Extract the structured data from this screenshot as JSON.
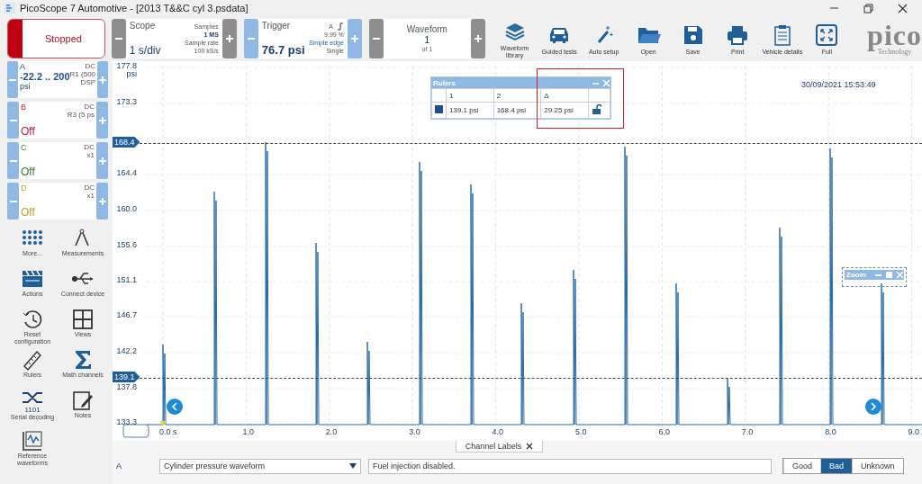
{
  "window": {
    "title": "PicoScope 7 Automotive - [2013 T&&C cyl 3.psdata]"
  },
  "run_button": {
    "label": "Stopped",
    "running": false
  },
  "scope": {
    "label": "Scope",
    "value": "1 s/div",
    "samples_label": "Samples",
    "samples": "1 MS",
    "rate_label": "Sample rate",
    "rate": "100 kS/s"
  },
  "trigger": {
    "label": "Trigger",
    "value": "76.7 psi",
    "channel": "A",
    "percent": "9.99 %",
    "type": "Simple edge",
    "mode": "Single"
  },
  "waveform": {
    "label": "Waveform",
    "value": "1",
    "of": "of 1"
  },
  "toolbar": [
    {
      "label": "Waveform library"
    },
    {
      "label": "Guided tests"
    },
    {
      "label": "Auto setup"
    },
    {
      "label": "Open"
    },
    {
      "label": "Save"
    },
    {
      "label": "Print"
    },
    {
      "label": "Vehicle details"
    },
    {
      "label": "Full"
    }
  ],
  "logo": {
    "name": "pico",
    "tagline": "Technology"
  },
  "channels": [
    {
      "name": "A",
      "color": "#1f4e8c",
      "coupling": "DC",
      "probe": "R1 (500",
      "extra": "DSP",
      "range": "-22.2 .. 200",
      "unit": "psi"
    },
    {
      "name": "B",
      "color": "#c0184a",
      "coupling": "DC",
      "probe": "R3 (5 ps",
      "range": "Off"
    },
    {
      "name": "C",
      "color": "#2e7d32",
      "coupling": "DC",
      "probe": "x1",
      "range": "Off"
    },
    {
      "name": "D",
      "color": "#b8a22a",
      "coupling": "DC",
      "probe": "x1",
      "range": "Off"
    }
  ],
  "tools": [
    {
      "label": "More..."
    },
    {
      "label": "Measurements"
    },
    {
      "label": "Actions"
    },
    {
      "label": "Connect device"
    },
    {
      "label": "Reset configuration"
    },
    {
      "label": "Views"
    },
    {
      "label": "Rulers"
    },
    {
      "label": "Math channels"
    },
    {
      "label": "Serial decoding",
      "badge": "1101"
    },
    {
      "label": "Notes"
    },
    {
      "label": "Reference waveforms"
    }
  ],
  "chart": {
    "y_unit": "psi",
    "y_ticks": [
      "177.8",
      "173.3",
      "164.4",
      "160.0",
      "155.6",
      "151.1",
      "146.7",
      "142.2",
      "137.8",
      "133.3"
    ],
    "x_ticks": [
      "0.0 s",
      "1.0",
      "2.0",
      "3.0",
      "4.0",
      "5.0",
      "6.0",
      "7.0",
      "8.0",
      "9.0"
    ],
    "rulers": [
      {
        "label": "168.4"
      },
      {
        "label": "139.1"
      }
    ],
    "date": "30/09/2021 15:53:49"
  },
  "rulers_window": {
    "title": "Rulers",
    "columns": [
      "1",
      "2",
      "Δ"
    ],
    "row": [
      "139.1 psi",
      "168.4 psi",
      "29.25 psi"
    ],
    "locked": false
  },
  "zoom_window": {
    "title": "Zoom"
  },
  "channel_labels": {
    "tab": "Channel Labels",
    "channel": "A",
    "waveform": "Cylinder pressure waveform",
    "note": "Fuel injection disabled.",
    "verdicts": [
      {
        "label": "Good",
        "selected": false
      },
      {
        "label": "Bad",
        "selected": true
      },
      {
        "label": "Unknown",
        "selected": false
      }
    ]
  }
}
